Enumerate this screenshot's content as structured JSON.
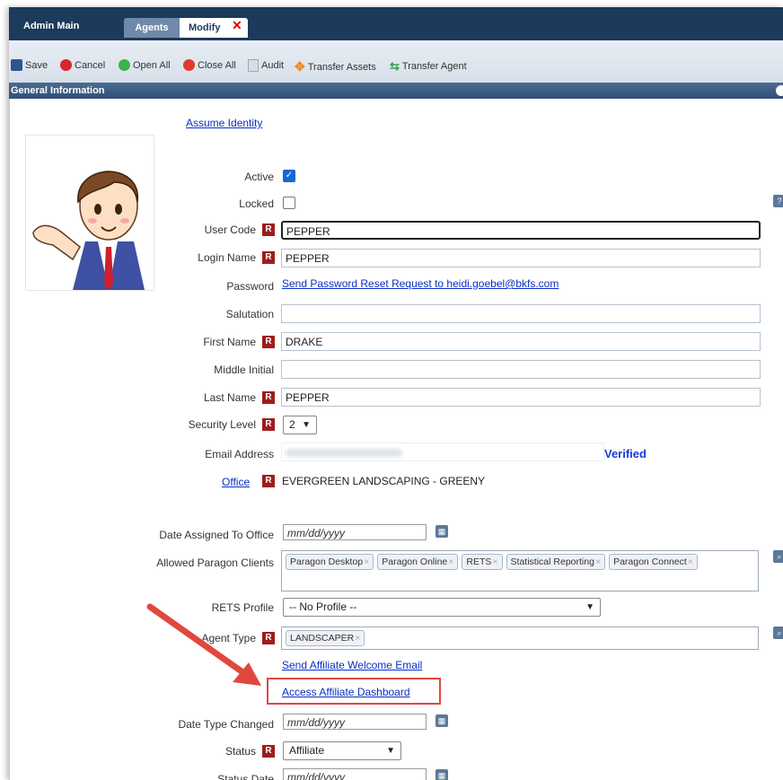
{
  "tabs": {
    "main": "Admin Main",
    "agents": "Agents",
    "modify": "Modify",
    "close": "✕"
  },
  "toolbar": {
    "save": "Save",
    "cancel": "Cancel",
    "open_all": "Open All",
    "close_all": "Close All",
    "audit": "Audit",
    "transfer_assets": "Transfer Assets",
    "transfer_agent": "Transfer Agent"
  },
  "section": {
    "title": "General Information"
  },
  "assume_identity": "Assume Identity",
  "labels": {
    "active": "Active",
    "locked": "Locked",
    "user_code": "User Code",
    "login_name": "Login Name",
    "password": "Password",
    "salutation": "Salutation",
    "first_name": "First Name",
    "middle_initial": "Middle Initial",
    "last_name": "Last Name",
    "security_level": "Security Level",
    "email_address": "Email Address",
    "office": "Office",
    "date_assigned": "Date Assigned To Office",
    "allowed_clients": "Allowed Paragon Clients",
    "rets_profile": "RETS Profile",
    "agent_type": "Agent Type",
    "date_type_changed": "Date Type Changed",
    "status": "Status",
    "status_date": "Status Date"
  },
  "values": {
    "user_code": "PEPPER",
    "login_name": "PEPPER",
    "password_link": "Send Password Reset Request to heidi.goebel@bkfs.com",
    "salutation": "",
    "first_name": "DRAKE",
    "middle_initial": "",
    "last_name": "PEPPER",
    "security_level": "2",
    "email_status": "Verified",
    "office": "EVERGREEN LANDSCAPING - GREENY",
    "date_placeholder": "mm/dd/yyyy",
    "rets_profile": "-- No Profile --",
    "agent_type_chip": "LANDSCAPER",
    "status": "Affiliate"
  },
  "allowed_clients": [
    "Paragon Desktop",
    "Paragon Online",
    "RETS",
    "Statistical Reporting",
    "Paragon Connect"
  ],
  "links": {
    "send_affiliate": "Send Affiliate Welcome Email",
    "access_dashboard": "Access Affiliate Dashboard"
  },
  "req_marker": "R",
  "help_marker": "?",
  "colors": {
    "header": "#1b3a5c",
    "required": "#a01c1c",
    "link": "#0a2ec4",
    "annotation": "#e0483e"
  }
}
